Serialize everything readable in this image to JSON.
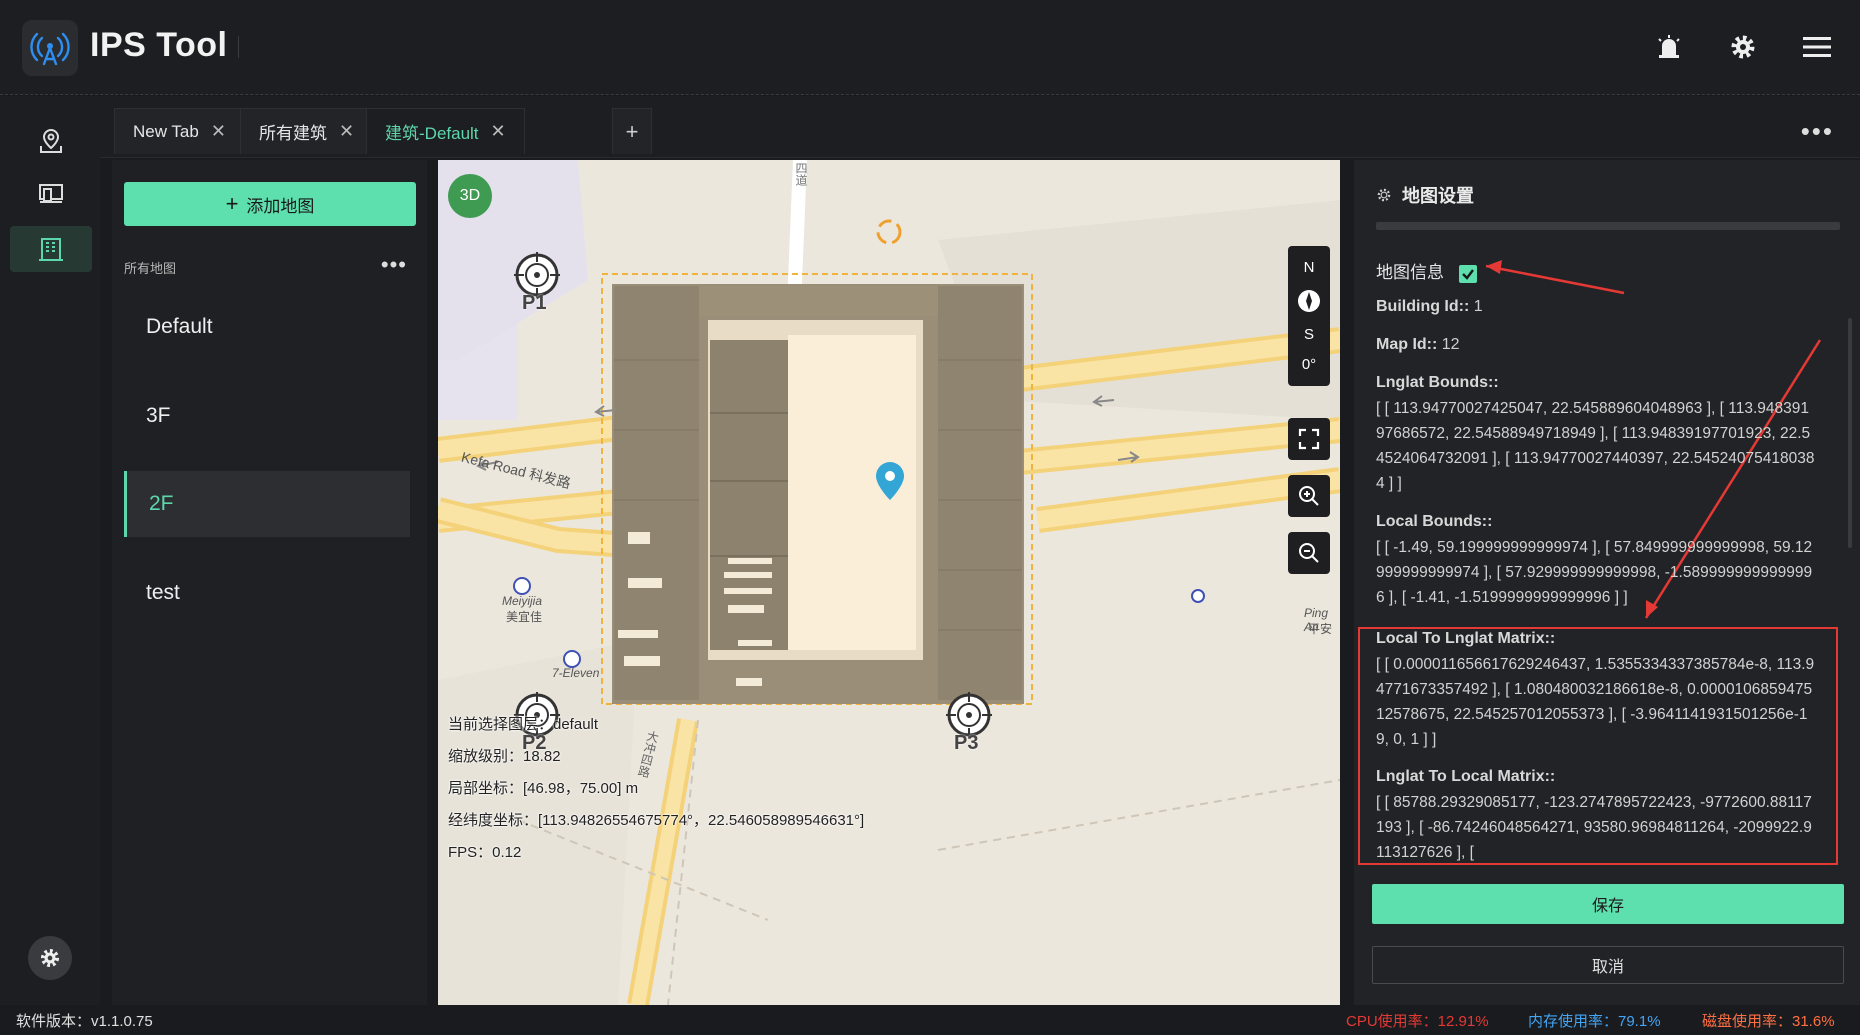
{
  "app": {
    "title": "IPS Tool"
  },
  "tabs": [
    {
      "label": "New Tab"
    },
    {
      "label": "所有建筑"
    },
    {
      "label": "建筑-Default"
    }
  ],
  "tab_add_label": "+",
  "tab_more_label": "•••",
  "map_list": {
    "add_button": "添加地图",
    "header": "所有地图",
    "more_label": "•••",
    "items": [
      "Default",
      "3F",
      "2F",
      "test"
    ],
    "active_index": 2
  },
  "map": {
    "btn_3d": "3D",
    "compass": {
      "north": "N",
      "south": "S",
      "angle": "0°"
    },
    "points": [
      "P1",
      "P2",
      "P3"
    ],
    "road_labels": [
      "Kefa Road 科发路",
      "Meiyijia",
      "美宜佳",
      "7-Eleven",
      "Ping An",
      "平安",
      "大冲四路",
      "四道"
    ],
    "info": {
      "layer": "当前选择图层：default",
      "zoom": "缩放级别：18.82",
      "local": "局部坐标：[46.98，75.00] m",
      "lnglat": "经纬度坐标：[113.94826554675774°，22.546058989546631°]",
      "fps": "FPS：0.12"
    }
  },
  "settings": {
    "title": "地图设置",
    "map_info_label": "地图信息",
    "building_id_label": "Building Id::",
    "building_id": "1",
    "map_id_label": "Map Id::",
    "map_id": "12",
    "lnglat_bounds_label": "Lnglat Bounds::",
    "lnglat_bounds": "[ [ 113.94770027425047, 22.545889604048963 ], [ 113.94839197686572, 22.54588949718949 ], [ 113.94839197701923, 22.54524064732091 ], [ 113.94770027440397, 22.545240754180384 ] ]",
    "local_bounds_label": "Local Bounds::",
    "local_bounds": "[ [ -1.49, 59.199999999999974 ], [ 57.849999999999998, 59.12999999999974 ], [ 57.929999999999998, -1.5899999999999996 ], [ -1.41, -1.5199999999999996 ] ]",
    "local_to_lnglat_label": "Local To Lnglat Matrix::",
    "local_to_lnglat": "[ [ 0.000011656617629246437, 1.5355334337385784e-8, 113.94771673357492 ], [ 1.080480032186618e-8, 0.000010685947512578675, 22.545257012055373 ], [ -3.9641141931501256e-19, 0, 1 ] ]",
    "lnglat_to_local_label": "Lnglat To Local Matrix::",
    "lnglat_to_local": "[ [ 85788.29329085177, -123.2747895722423, -9772600.88117193 ], [ -86.74246048564271, 93580.96984811264, -2099922.9113127626 ], [",
    "save_button": "保存",
    "cancel_button": "取消"
  },
  "status": {
    "version": "软件版本：v1.1.0.75",
    "cpu": "CPU使用率：12.91%",
    "mem": "内存使用率：79.1%",
    "disk": "磁盘使用率：31.6%"
  },
  "colors": {
    "accent": "#5ddfae",
    "cpu": "#e53935",
    "mem": "#42a5f5",
    "disk": "#ff7043",
    "highlight": "#e53935"
  }
}
